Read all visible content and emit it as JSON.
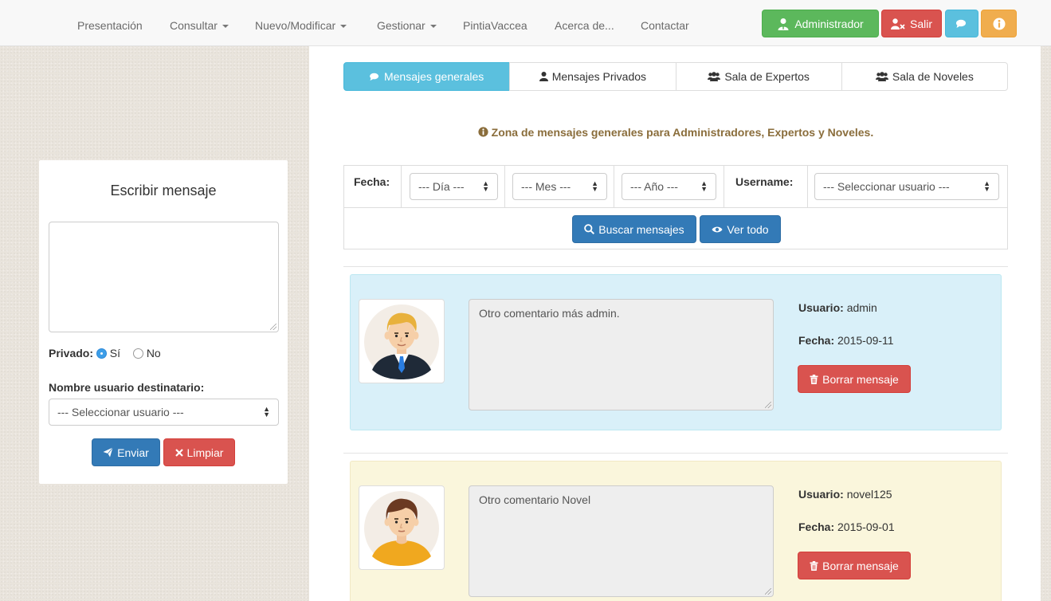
{
  "navbar": {
    "items": [
      {
        "label": "Presentación"
      },
      {
        "label": "Consultar"
      },
      {
        "label": "Nuevo/Modificar"
      },
      {
        "label": "Gestionar"
      },
      {
        "label": "PintiaVaccea"
      },
      {
        "label": "Acerca de..."
      },
      {
        "label": "Contactar"
      }
    ],
    "admin_label": "Administrador",
    "logout_label": "Salir",
    "chat_icon": "comments-icon",
    "info_icon": "info-circle-icon"
  },
  "tabs": [
    {
      "label": "Mensajes generales",
      "icon": "comments-icon",
      "active": true
    },
    {
      "label": "Mensajes Privados",
      "icon": "user-icon",
      "active": false
    },
    {
      "label": "Sala de Expertos",
      "icon": "users-icon",
      "active": false
    },
    {
      "label": "Sala de Noveles",
      "icon": "users-icon",
      "active": false
    }
  ],
  "zone_notice": "Zona de mensajes generales para Administradores, Expertos y Noveles.",
  "search": {
    "date_label": "Fecha:",
    "day_select": "--- Día ---",
    "month_select": "--- Mes ---",
    "year_select": "--- Año ---",
    "username_label": "Username:",
    "user_select": "--- Seleccionar usuario ---",
    "search_button": "Buscar mensajes",
    "view_all_button": "Ver todo"
  },
  "messages": [
    {
      "text": "Otro comentario más admin.",
      "user_label": "Usuario:",
      "user": "admin",
      "date_label": "Fecha:",
      "date": "2015-09-11",
      "delete_label": "Borrar mensaje",
      "bg": "#d9f0f9"
    },
    {
      "text": "Otro comentario Novel",
      "user_label": "Usuario:",
      "user": "novel125",
      "date_label": "Fecha:",
      "date": "2015-09-01",
      "delete_label": "Borrar mensaje",
      "bg": "#faf6dc"
    }
  ],
  "compose": {
    "title": "Escribir mensaje",
    "textarea_value": "",
    "private_label": "Privado:",
    "option_yes": "Sí",
    "option_no": "No",
    "private_selected": "Sí",
    "recipient_label": "Nombre usuario destinatario:",
    "recipient_select": "--- Seleccionar usuario ---",
    "send_button": "Enviar",
    "clear_button": "Limpiar"
  },
  "colors": {
    "primary": "#337ab7",
    "danger": "#d9534f",
    "success": "#5cb85c",
    "info": "#5bc0de",
    "warning": "#f0ad4e",
    "notice_text": "#8a6d3b"
  }
}
